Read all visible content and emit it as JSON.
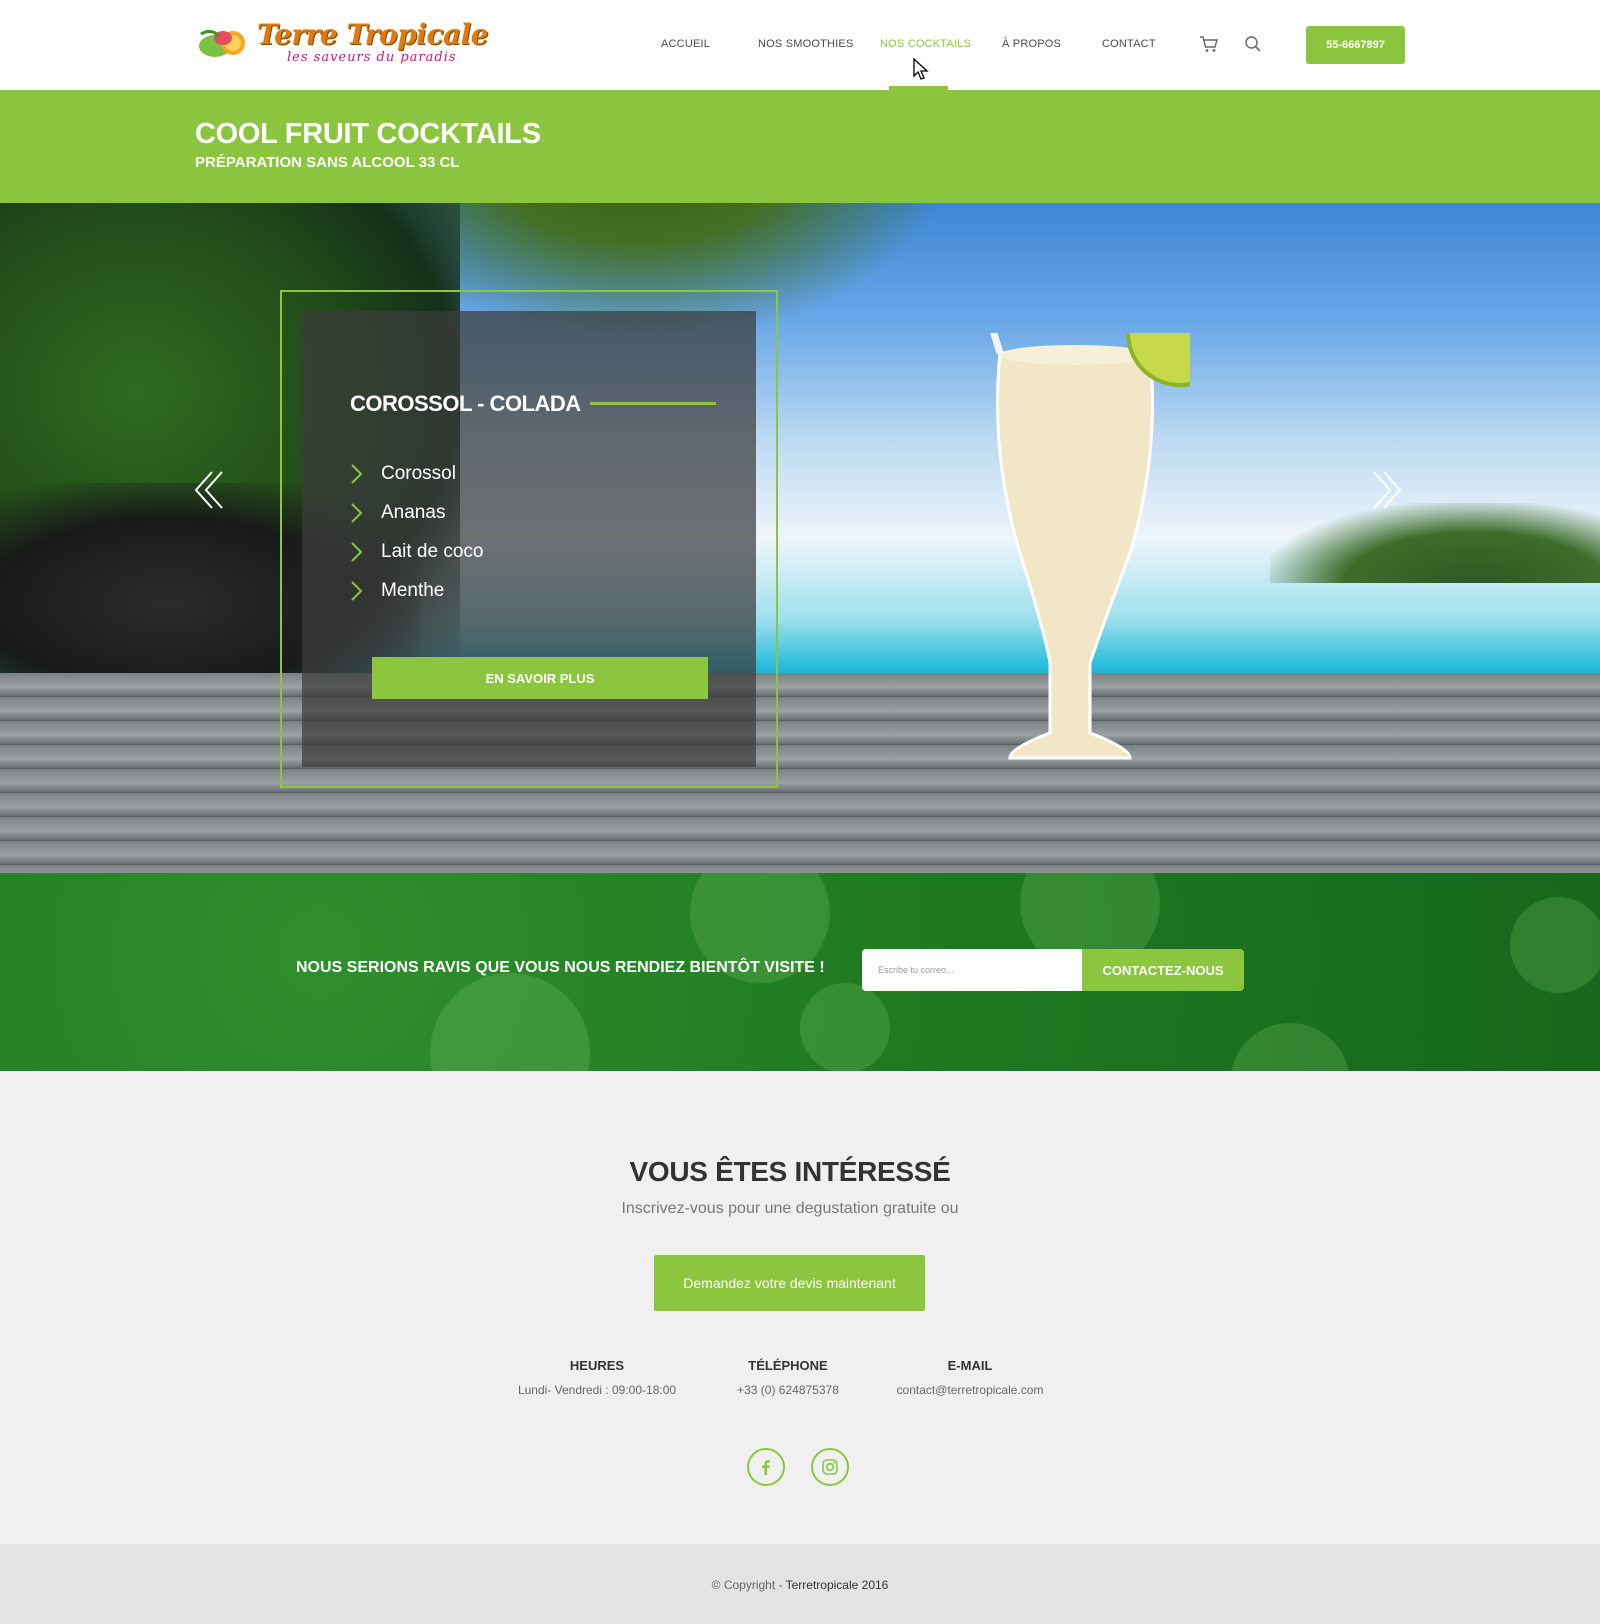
{
  "header": {
    "logo": {
      "title": "Terre Tropicale",
      "tagline": "les saveurs du paradis"
    },
    "nav": [
      {
        "label": "ACCUEIL"
      },
      {
        "label": "NOS SMOOTHIES"
      },
      {
        "label": "NOS COCKTAILS",
        "active": true
      },
      {
        "label": "À PROPOS"
      },
      {
        "label": "CONTACT"
      }
    ],
    "icons": [
      "cart-icon",
      "search-icon"
    ],
    "phone_button": "55-6667897"
  },
  "title_band": {
    "title": "COOL FRUIT COCKTAILS",
    "subtitle": "PRÉPARATION SANS ALCOOL 33 CL"
  },
  "hero": {
    "card": {
      "title": "COROSSOL - COLADA",
      "ingredients": [
        "Corossol",
        "Ananas",
        "Lait de coco",
        "Menthe"
      ],
      "button": "EN SAVOIR PLUS"
    },
    "prev_icon": "double-chevron-left-icon",
    "next_icon": "double-chevron-right-icon"
  },
  "newsletter": {
    "text": "NOUS SERIONS RAVIS QUE VOUS NOUS RENDIEZ BIENTÔT VISITE !",
    "placeholder": "Escribe tu correo...",
    "button": "CONTACTEZ-NOUS"
  },
  "interested": {
    "title": "VOUS ÊTES INTÉRESSÉ",
    "subtitle": "Inscrivez-vous pour une degustation gratuite ou",
    "button": "Demandez votre devis maintenant",
    "info": [
      {
        "head": "HEURES",
        "value": "Lundi- Vendredi : 09:00-18:00"
      },
      {
        "head": "TÉLÉPHONE",
        "value": "+33 (0) 624875378"
      },
      {
        "head": "E-MAIL",
        "value": "contact@terretropicale.com"
      }
    ],
    "social": [
      "facebook-icon",
      "instagram-icon"
    ]
  },
  "footer": {
    "copyright_prefix": "© Copyright - ",
    "brand": "Terretropicale 2016"
  },
  "colors": {
    "accent": "#8cc63f",
    "dark_green": "#1f7a22",
    "text_dark": "#333333"
  }
}
